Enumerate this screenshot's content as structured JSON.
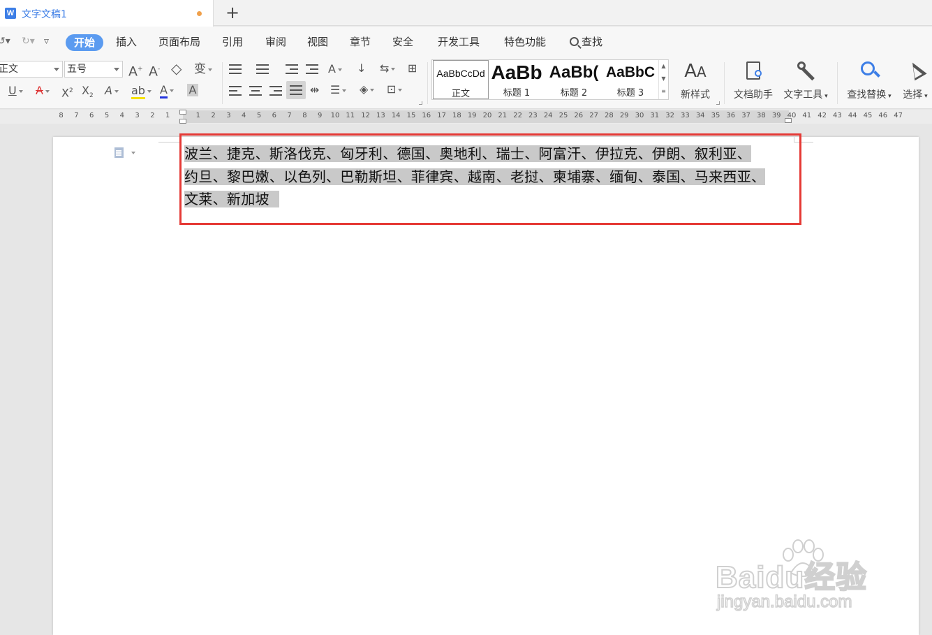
{
  "tab": {
    "title": "文字文稿1",
    "new_tab": "+"
  },
  "menu": {
    "items": [
      "开始",
      "插入",
      "页面布局",
      "引用",
      "审阅",
      "视图",
      "章节",
      "安全",
      "开发工具",
      "特色功能"
    ],
    "active": "开始",
    "search": "查找"
  },
  "ribbon": {
    "font_name": "正文",
    "font_size": "五号",
    "styles": [
      {
        "sample": "AaBbCcDd",
        "name": "正文"
      },
      {
        "sample": "AaBb",
        "name": "标题 1"
      },
      {
        "sample": "AaBb(",
        "name": "标题 2"
      },
      {
        "sample": "AaBbC",
        "name": "标题 3"
      }
    ],
    "new_style": "新样式",
    "doc_assistant": "文档助手",
    "text_tools": "文字工具",
    "find_replace": "查找替换",
    "select": "选择"
  },
  "ruler": {
    "left": [
      "8",
      "7",
      "6",
      "5",
      "4",
      "3",
      "2",
      "1"
    ],
    "right": [
      "1",
      "2",
      "3",
      "4",
      "5",
      "6",
      "7",
      "8",
      "9",
      "10",
      "11",
      "12",
      "13",
      "14",
      "15",
      "16",
      "17",
      "18",
      "19",
      "20",
      "21",
      "22",
      "23",
      "24",
      "25",
      "26",
      "27",
      "28",
      "29",
      "30",
      "31",
      "32",
      "33",
      "34",
      "35",
      "36",
      "37",
      "38",
      "39",
      "40",
      "41",
      "42",
      "43",
      "44",
      "45",
      "46",
      "47"
    ]
  },
  "document": {
    "lines": [
      "波兰、捷克、斯洛伐克、匈牙利、德国、奥地利、瑞士、阿富汗、伊拉克、伊朗、叙利亚、",
      "约旦、黎巴嫩、以色列、巴勒斯坦、菲律宾、越南、老挝、柬埔寨、缅甸、泰国、马来西亚、",
      "文莱、新加坡"
    ]
  },
  "watermark": {
    "logo": "Baidu经验",
    "url": "jingyan.baidu.com"
  },
  "colors": {
    "accent": "#5b9bf0",
    "highlight_box": "#e53935",
    "selection": "#c9c9c9"
  }
}
